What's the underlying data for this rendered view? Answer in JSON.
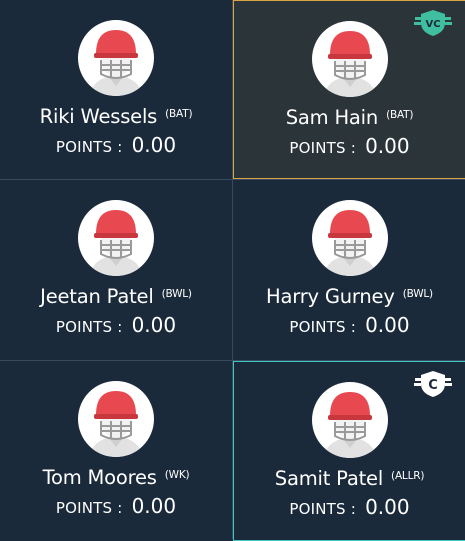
{
  "players": [
    {
      "name": "Riki Wessels",
      "role": "(BAT)",
      "points_label": "POINTS :",
      "points_value": "0.00",
      "badge": ""
    },
    {
      "name": "Sam Hain",
      "role": "(BAT)",
      "points_label": "POINTS :",
      "points_value": "0.00",
      "badge": "VC"
    },
    {
      "name": "Jeetan Patel",
      "role": "(BWL)",
      "points_label": "POINTS :",
      "points_value": "0.00",
      "badge": ""
    },
    {
      "name": "Harry Gurney",
      "role": "(BWL)",
      "points_label": "POINTS :",
      "points_value": "0.00",
      "badge": ""
    },
    {
      "name": "Tom Moores",
      "role": "(WK)",
      "points_label": "POINTS :",
      "points_value": "0.00",
      "badge": ""
    },
    {
      "name": "Samit Patel",
      "role": "(ALLR)",
      "points_label": "POINTS :",
      "points_value": "0.00",
      "badge": "C"
    }
  ],
  "colors": {
    "background": "#1b2a3b",
    "vice_captain_border": "#d9a441",
    "captain_border": "#3ec6c0",
    "helmet": "#e8484f",
    "vc_badge": "#3fbfa0"
  },
  "icons": {
    "avatar": "cricket-player-helmet-icon",
    "vc_badge": "vice-captain-shield-icon",
    "c_badge": "captain-shield-icon"
  }
}
